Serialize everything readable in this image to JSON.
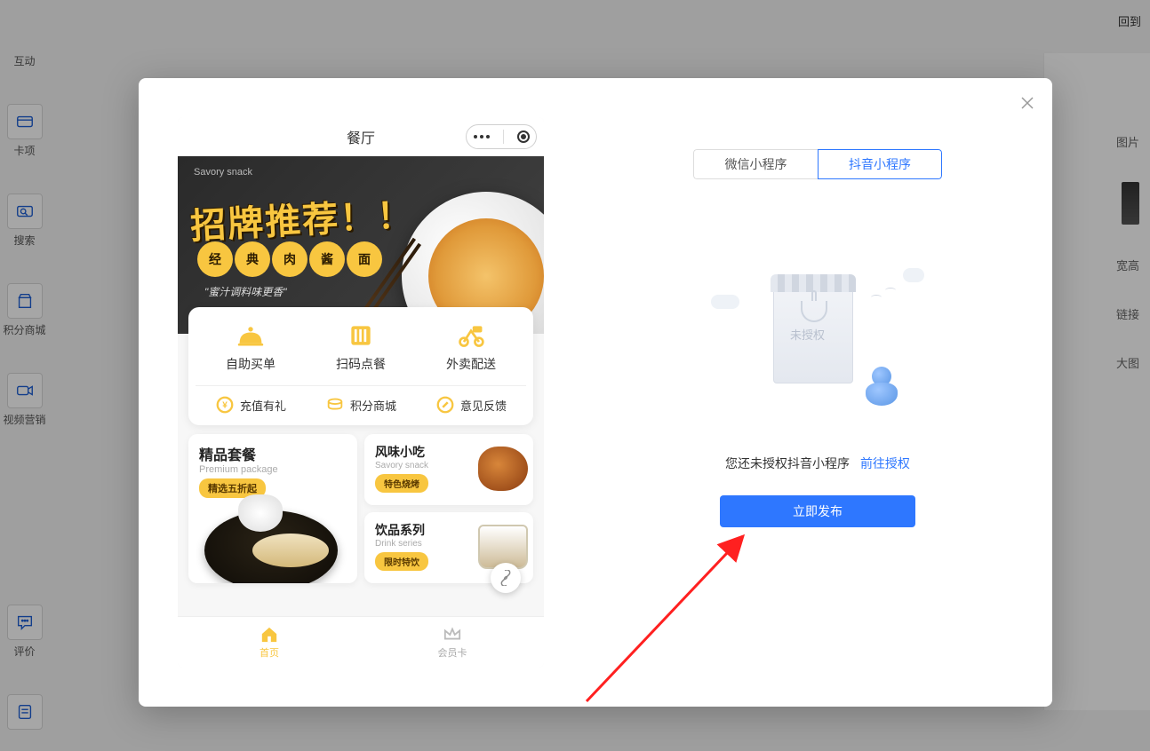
{
  "topbar": {
    "back": "回到"
  },
  "sidebar": {
    "items": [
      {
        "label": "互动"
      },
      {
        "label": "卡项"
      },
      {
        "label": "搜索"
      },
      {
        "label": "积分商城"
      },
      {
        "label": "视频营销"
      },
      {
        "label": "评价"
      }
    ]
  },
  "right_panel": {
    "labels": [
      "图片",
      "宽高",
      "链接",
      "大图"
    ]
  },
  "modal": {
    "phone": {
      "title": "餐厅",
      "banner": {
        "small_label": "Savory snack",
        "title": "招牌推荐！！",
        "circle_text": [
          "经",
          "典",
          "肉",
          "酱",
          "面"
        ],
        "subtitle": "\"蜜汁调料味更香\""
      },
      "big_menu": [
        {
          "label": "自助买单"
        },
        {
          "label": "扫码点餐"
        },
        {
          "label": "外卖配送"
        }
      ],
      "small_menu": [
        {
          "label": "充值有礼"
        },
        {
          "label": "积分商城"
        },
        {
          "label": "意见反馈"
        }
      ],
      "categories": {
        "big": {
          "title": "精品套餐",
          "sub": "Premium package",
          "badge": "精选五折起"
        },
        "small1": {
          "title": "风味小吃",
          "sub": "Savory snack",
          "badge": "特色烧烤"
        },
        "small2": {
          "title": "饮品系列",
          "sub": "Drink series",
          "badge": "限时特饮"
        }
      },
      "tabs": {
        "home": "首页",
        "member": "会员卡"
      }
    },
    "config": {
      "tab_wechat": "微信小程序",
      "tab_douyin": "抖音小程序",
      "illus_label": "未授权",
      "auth_text": "您还未授权抖音小程序",
      "auth_link": "前往授权",
      "publish_btn": "立即发布"
    }
  }
}
